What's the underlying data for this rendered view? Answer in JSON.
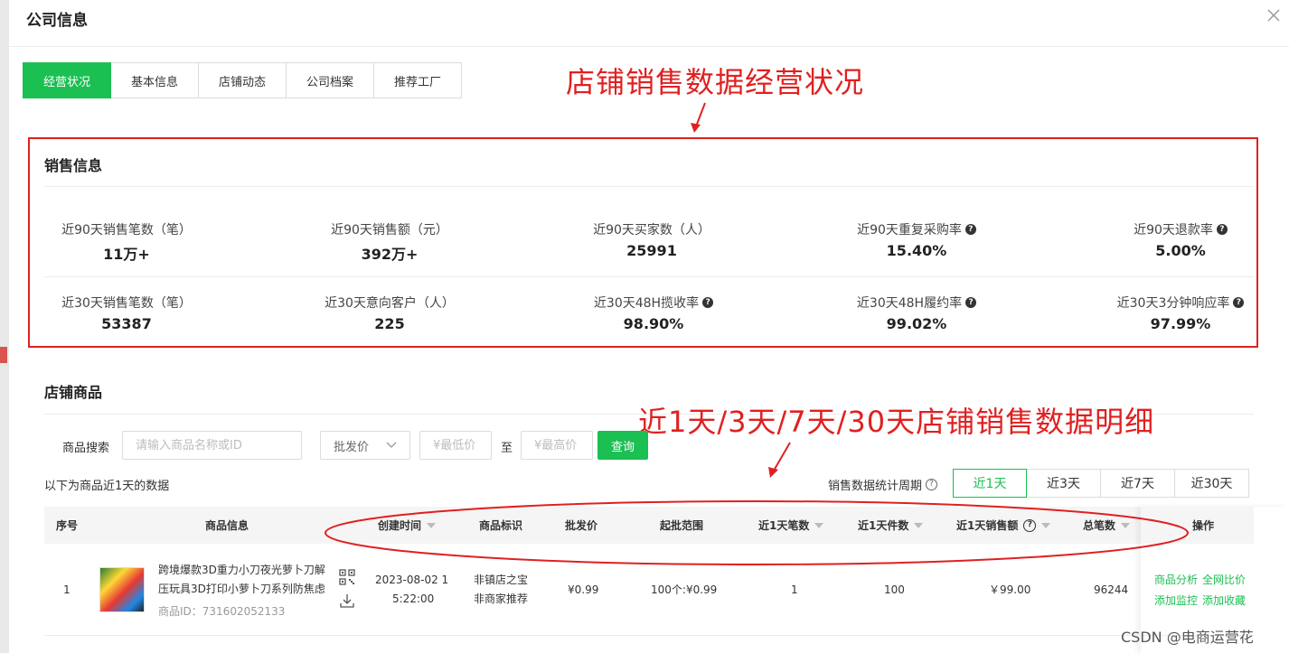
{
  "modal": {
    "title": "公司信息"
  },
  "tabs": [
    {
      "label": "经营状况",
      "active": true
    },
    {
      "label": "基本信息",
      "active": false
    },
    {
      "label": "店铺动态",
      "active": false
    },
    {
      "label": "公司档案",
      "active": false
    },
    {
      "label": "推荐工厂",
      "active": false
    }
  ],
  "annotations": {
    "top": "店铺销售数据经营状况",
    "middle": "近1天/3天/7天/30天店铺销售数据明细",
    "color": "#e02020"
  },
  "sales_info": {
    "title": "销售信息",
    "row1": [
      {
        "label": "近90天销售笔数（笔）",
        "value": "11万+",
        "help": false
      },
      {
        "label": "近90天销售额（元）",
        "value": "392万+",
        "help": false
      },
      {
        "label": "近90天买家数（人）",
        "value": "25991",
        "help": false
      },
      {
        "label": "近90天重复采购率",
        "value": "15.40%",
        "help": true
      },
      {
        "label": "近90天退款率",
        "value": "5.00%",
        "help": true
      }
    ],
    "row2": [
      {
        "label": "近30天销售笔数（笔）",
        "value": "53387",
        "help": false
      },
      {
        "label": "近30天意向客户（人）",
        "value": "225",
        "help": false
      },
      {
        "label": "近30天48H揽收率",
        "value": "98.90%",
        "help": true
      },
      {
        "label": "近30天48H履约率",
        "value": "99.02%",
        "help": true
      },
      {
        "label": "近30天3分钟响应率",
        "value": "97.99%",
        "help": true
      }
    ]
  },
  "store_goods": {
    "title": "店铺商品",
    "search_label": "商品搜索",
    "search_placeholder": "请输入商品名称或ID",
    "price_type": "批发价",
    "min_placeholder": "¥最低价",
    "range_sep": "至",
    "max_placeholder": "¥最高价",
    "query_label": "查询",
    "period_note": "以下为商品近1天的数据",
    "period_label": "销售数据统计周期",
    "periods": [
      "近1天",
      "近3天",
      "近7天",
      "近30天"
    ],
    "active_period": "近1天"
  },
  "table": {
    "headers": {
      "seq": "序号",
      "info": "商品信息",
      "created": "创建时间",
      "tag": "商品标识",
      "price": "批发价",
      "range": "起批范围",
      "orders": "近1天笔数",
      "pieces": "近1天件数",
      "amount": "近1天销售额",
      "total": "总笔数",
      "op": "操作"
    },
    "rows": [
      {
        "seq": "1",
        "name_line1": "跨境爆款3D重力小刀夜光萝卜刀解",
        "name_line2": "压玩具3D打印小萝卜刀系列防焦虑",
        "product_id": "商品ID：731602052133",
        "created_line1": "2023-08-02 1",
        "created_line2": "5:22:00",
        "tag_line1": "非镇店之宝",
        "tag_line2": "非商家推荐",
        "price": "¥0.99",
        "range": "100个:¥0.99",
        "orders": "1",
        "pieces": "100",
        "amount": "￥99.00",
        "total": "96244",
        "ops": [
          "商品分析",
          "全网比价",
          "添加监控",
          "添加收藏"
        ]
      }
    ]
  },
  "watermark": "CSDN @电商运营花",
  "colors": {
    "accent": "#1bbf52",
    "annotation": "#e02020"
  }
}
